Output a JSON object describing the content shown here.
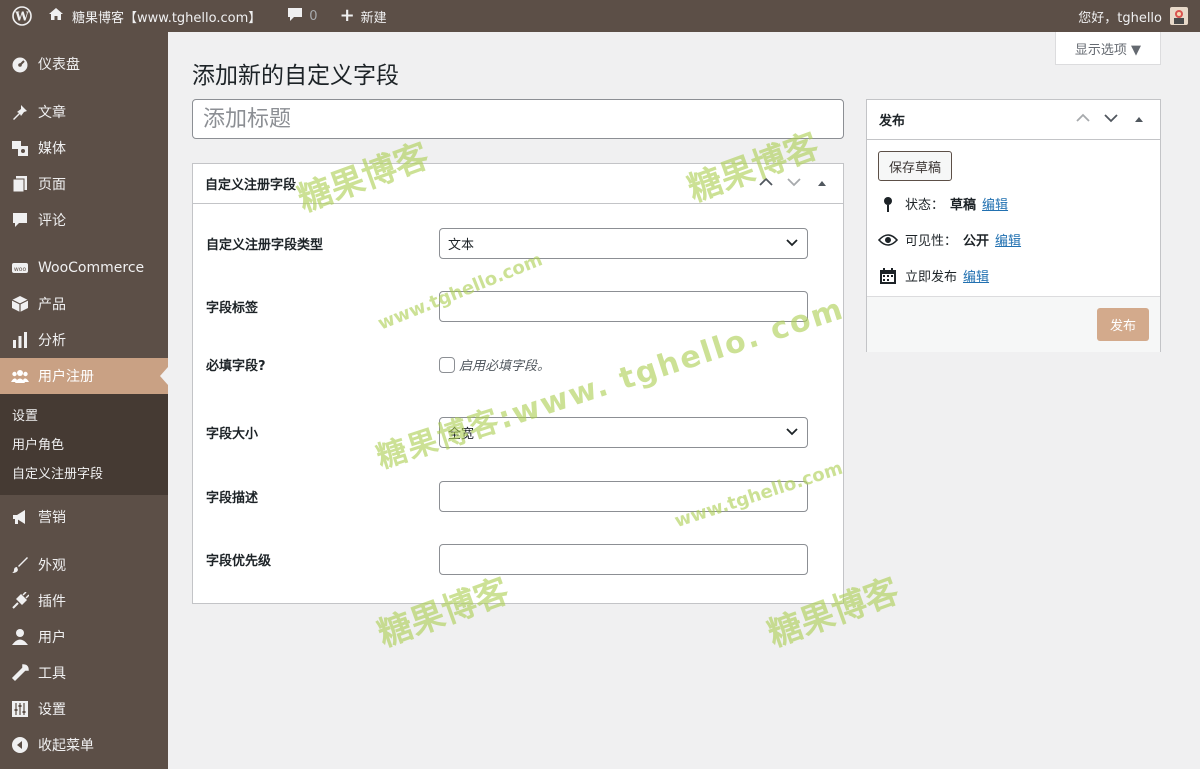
{
  "adminbar": {
    "site_name": "糖果博客【www.tghello.com】",
    "comments_count": "0",
    "new_label": "新建",
    "greeting": "您好，tghello"
  },
  "sidebar": {
    "items": [
      {
        "label": "仪表盘",
        "icon": "dashboard-icon"
      },
      {
        "label": "文章",
        "icon": "pushpin-icon"
      },
      {
        "label": "媒体",
        "icon": "media-icon"
      },
      {
        "label": "页面",
        "icon": "page-icon"
      },
      {
        "label": "评论",
        "icon": "comment-icon"
      },
      {
        "label": "WooCommerce",
        "icon": "woocommerce-icon"
      },
      {
        "label": "产品",
        "icon": "product-box-icon"
      },
      {
        "label": "分析",
        "icon": "bar-chart-icon"
      },
      {
        "label": "用户注册",
        "icon": "users-group-icon"
      },
      {
        "label": "营销",
        "icon": "megaphone-icon"
      },
      {
        "label": "外观",
        "icon": "brush-icon"
      },
      {
        "label": "插件",
        "icon": "plug-icon"
      },
      {
        "label": "用户",
        "icon": "user-icon"
      },
      {
        "label": "工具",
        "icon": "wrench-icon"
      },
      {
        "label": "设置",
        "icon": "settings-sliders-icon"
      },
      {
        "label": "收起菜单",
        "icon": "collapse-arrow-icon"
      }
    ],
    "submenu": [
      "设置",
      "用户角色",
      "自定义注册字段"
    ]
  },
  "screen_options": "显示选项 ▼",
  "page_title": "添加新的自定义字段",
  "title_placeholder": "添加标题",
  "metabox": {
    "title": "自定义注册字段",
    "fields": {
      "type_label": "自定义注册字段类型",
      "type_value": "文本",
      "label_label": "字段标签",
      "required_label": "必填字段?",
      "required_checkbox": "启用必填字段。",
      "size_label": "字段大小",
      "size_value": "全宽",
      "desc_label": "字段描述",
      "priority_label": "字段优先级"
    }
  },
  "publish": {
    "title": "发布",
    "save_draft": "保存草稿",
    "status_label": "状态：",
    "status_value": "草稿",
    "visibility_label": "可见性：",
    "visibility_value": "公开",
    "schedule_label": "立即发布",
    "edit_link": "编辑",
    "publish_button": "发布"
  },
  "watermarks": {
    "cn": "糖果博客",
    "url": "www.tghello.com",
    "combo": "糖果博客:www. tghello. com"
  },
  "colors": {
    "adminbar_bg": "#5c4f47",
    "sidebar_active": "#c9a184",
    "publish_button": "#d3aa8c",
    "link": "#2271b1"
  }
}
